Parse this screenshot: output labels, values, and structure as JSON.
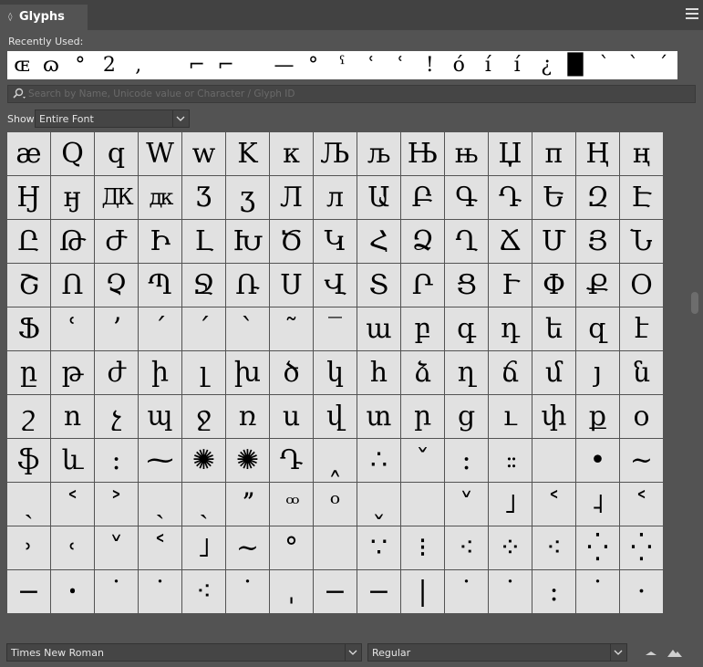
{
  "tab": {
    "title": "Glyphs"
  },
  "recently_used": {
    "label": "Recently Used:",
    "glyphs": [
      "ɶ",
      "ɷ",
      "°",
      "2",
      ",",
      "",
      "⌐",
      "⌐",
      "",
      "—",
      "°",
      "ˁ",
      "ʿ",
      "ʿ",
      "!",
      "ó",
      "í",
      "í",
      "¿",
      "█",
      "`",
      "ˋ",
      "ˊ"
    ]
  },
  "search": {
    "placeholder": "Search by Name, Unicode value or Character / Glyph ID"
  },
  "show": {
    "label": "Show:",
    "value": "Entire Font"
  },
  "grid": {
    "rows": [
      [
        "æ",
        "Q",
        "q",
        "W",
        "w",
        "K",
        "к",
        "Љ",
        "љ",
        "Њ",
        "њ",
        "Џ",
        "п",
        "Ң",
        "ң"
      ],
      [
        "Ӈ",
        "ӈ",
        "ДК",
        "дк",
        "Ӡ",
        "ӡ",
        "Л",
        "л",
        "Ա",
        "Բ",
        "Գ",
        "Դ",
        "Ե",
        "Զ",
        "Է"
      ],
      [
        "Ը",
        "Թ",
        "Ժ",
        "Ի",
        "Լ",
        "Խ",
        "Ծ",
        "Կ",
        "Հ",
        "Ձ",
        "Ղ",
        "Ճ",
        "Մ",
        "Յ",
        "Ն"
      ],
      [
        "Շ",
        "Ո",
        "Չ",
        "Պ",
        "Ջ",
        "Ռ",
        "Ս",
        "Վ",
        "Տ",
        "Ր",
        "Ց",
        "Ւ",
        "Փ",
        "Ք",
        "Օ"
      ],
      [
        "Ֆ",
        "ʿ",
        "ʼ",
        "ˊ",
        "ˊ",
        "ˋ",
        "˜",
        "‾",
        "ա",
        "բ",
        "գ",
        "դ",
        "ե",
        "զ",
        "է"
      ],
      [
        "ը",
        "թ",
        "ժ",
        "ի",
        "լ",
        "խ",
        "ծ",
        "կ",
        "հ",
        "ձ",
        "ղ",
        "ճ",
        "մ",
        "յ",
        "ն"
      ],
      [
        "շ",
        "ո",
        "չ",
        "պ",
        "ջ",
        "ռ",
        "ս",
        "վ",
        "տ",
        "ր",
        "ց",
        "ւ",
        "փ",
        "ք",
        "օ"
      ],
      [
        "ֆ",
        "և",
        ":",
        "⁓",
        "✺",
        "✺",
        "Դ",
        "˰",
        "∴",
        "ˇ",
        ":",
        "::",
        "",
        "•",
        "~"
      ],
      [
        "ˎ",
        "˂",
        "˃",
        "ˏ",
        "ˏ",
        "ˮ",
        "ᵒᵒ",
        "ᵒ",
        "˯",
        "",
        "˅",
        "˩",
        "˂",
        "˨",
        "˂"
      ],
      [
        "˒",
        "˓",
        "˅",
        "˂",
        "˩",
        "~",
        "°",
        "",
        "∵",
        "⁝",
        "⁖",
        "⁘",
        "⁖",
        "⁛",
        "⁛"
      ],
      [
        "−",
        "ꞏ",
        "˙",
        "˙",
        "⁖",
        "˙",
        "ˌ",
        "−",
        "−",
        "|",
        "˙",
        "˙",
        ":",
        "˙",
        "·"
      ]
    ]
  },
  "font_family": {
    "value": "Times New Roman"
  },
  "font_style": {
    "value": "Regular"
  },
  "colors": {
    "panel_bg": "#535353",
    "cell_bg": "#e1e1e1",
    "tab_bg": "#424242"
  }
}
